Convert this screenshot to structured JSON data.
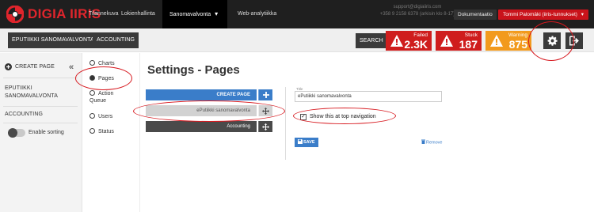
{
  "brand": {
    "logo_text": "DIGIA IIRIS",
    "color": "#e0252c"
  },
  "nav": {
    "items": [
      {
        "label": "Tilannekuva"
      },
      {
        "label": "Lokienhallinta"
      },
      {
        "label": "Sanomavalvonta",
        "active": true
      },
      {
        "label": "Web-analytiikka"
      }
    ],
    "caret": "▾"
  },
  "support": {
    "line1": "support@digiaiiris.com",
    "line2": "+358 9 2158 6378 (arkisin klo 8-17)"
  },
  "header_buttons": {
    "docs": "Dokumentaatio",
    "user": "Tommi Palomäki (iiris-tunnukset)",
    "user_caret": "▾"
  },
  "toolbar": {
    "project": "EPUTIIKKI SANOMAVALVONTA",
    "accounting": "ACCOUNTING",
    "search": "SEARCH",
    "alerts": [
      {
        "label": "Failed",
        "value": "2.3K",
        "color": "#cf1d1d"
      },
      {
        "label": "Stuck",
        "value": "187",
        "color": "#cf1d1d"
      },
      {
        "label": "Warning",
        "value": "875",
        "color": "#f29a1d"
      }
    ],
    "settings_icon": "gear-icon",
    "logout_icon": "logout-icon"
  },
  "sidebar": {
    "create_page": "CREATE PAGE",
    "collapse": "«",
    "items": [
      {
        "label": "EPUTIIKKI SANOMAVALVONTA"
      },
      {
        "label": "ACCOUNTING"
      }
    ],
    "toggle_label": "Enable sorting"
  },
  "subnav": {
    "items": [
      {
        "label": "Charts"
      },
      {
        "label": "Pages",
        "selected": true
      },
      {
        "label": "Action Queue"
      },
      {
        "label": "Users"
      },
      {
        "label": "Status"
      }
    ]
  },
  "main": {
    "title": "Settings - Pages",
    "pages": [
      {
        "label": "CREATE PAGE",
        "style": "blue",
        "icon": "plus-icon"
      },
      {
        "label": "ePutiikki sanomavalvonta",
        "style": "gray",
        "icon": "move-icon"
      },
      {
        "label": "Accounting",
        "style": "dark",
        "icon": "move-icon"
      }
    ],
    "form": {
      "title_label": "Title",
      "title_value": "ePutiikki sanomavalvonta",
      "checkbox_label": "Show this at top navigation",
      "checkbox_mark": "✓",
      "save": "SAVE",
      "remove": "Remove"
    }
  },
  "annotation_color": "#d7191f"
}
